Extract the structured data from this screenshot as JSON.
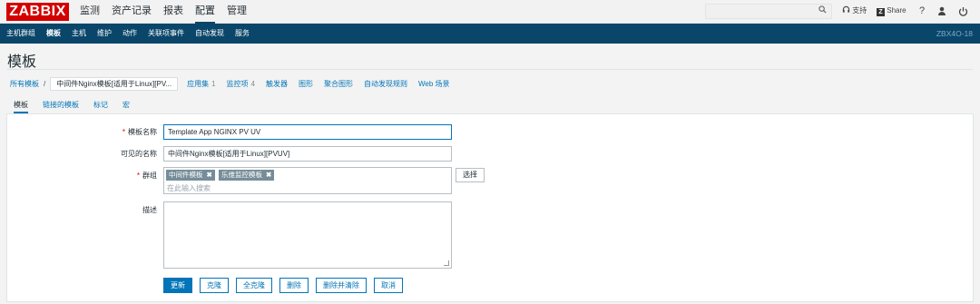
{
  "logo": "ZABBIX",
  "top_nav": [
    {
      "label": "监测",
      "active": false
    },
    {
      "label": "资产记录",
      "active": false
    },
    {
      "label": "报表",
      "active": false
    },
    {
      "label": "配置",
      "active": true
    },
    {
      "label": "管理",
      "active": false
    }
  ],
  "top_right": {
    "support": "支持",
    "share": "Share",
    "help": "?"
  },
  "sub_nav": [
    {
      "label": "主机群组",
      "active": false
    },
    {
      "label": "模板",
      "active": true
    },
    {
      "label": "主机",
      "active": false
    },
    {
      "label": "维护",
      "active": false
    },
    {
      "label": "动作",
      "active": false
    },
    {
      "label": "关联项事件",
      "active": false
    },
    {
      "label": "自动发现",
      "active": false
    },
    {
      "label": "服务",
      "active": false
    }
  ],
  "server_name": "ZBX4O-18",
  "page_title": "模板",
  "breadcrumb": {
    "all_templates": "所有模板",
    "separator": "/",
    "current": "中间件Nginx模板[适用于Linux][PV...",
    "tabs": [
      {
        "label": "应用集",
        "count": "1"
      },
      {
        "label": "监控项",
        "count": "4"
      },
      {
        "label": "触发器",
        "count": ""
      },
      {
        "label": "图形",
        "count": ""
      },
      {
        "label": "聚合图形",
        "count": ""
      },
      {
        "label": "自动发现规则",
        "count": ""
      },
      {
        "label": "Web 场景",
        "count": ""
      }
    ]
  },
  "form_tabs": [
    {
      "label": "模板",
      "active": true
    },
    {
      "label": "链接的模板",
      "active": false
    },
    {
      "label": "标记",
      "active": false
    },
    {
      "label": "宏",
      "active": false
    }
  ],
  "form": {
    "template_name_label": "模板名称",
    "template_name_value": "Template App NGINX PV UV",
    "visible_name_label": "可见的名称",
    "visible_name_value": "中间件Nginx模板[适用于Linux][PVUV]",
    "groups_label": "群组",
    "groups": [
      "中间件模板",
      "乐维监控模板"
    ],
    "groups_placeholder": "在此输入搜索",
    "select_button": "选择",
    "description_label": "描述",
    "description_value": ""
  },
  "actions": {
    "update": "更新",
    "clone": "克隆",
    "full_clone": "全克隆",
    "delete": "删除",
    "delete_clear": "删除并清除",
    "cancel": "取消"
  },
  "colors": {
    "brand": "#d40000",
    "nav_bg": "#0a466a",
    "link": "#0275b8",
    "chip": "#768d99"
  }
}
